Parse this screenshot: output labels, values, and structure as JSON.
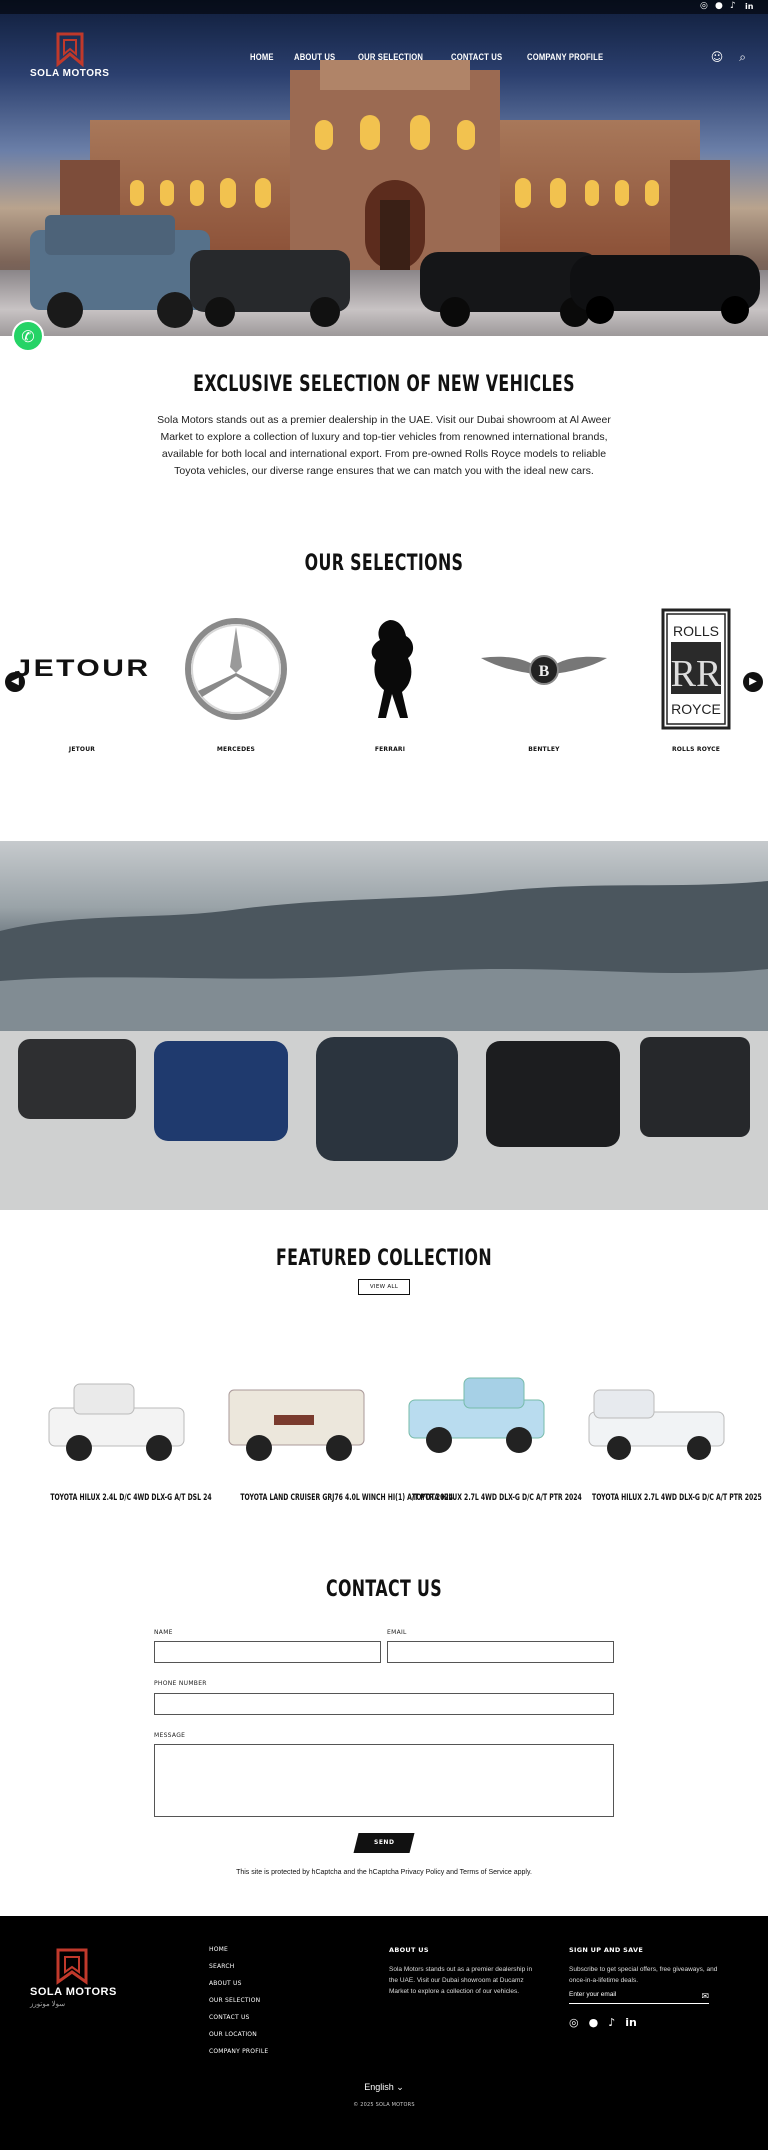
{
  "topbar": {
    "social_icons": [
      "instagram-icon",
      "facebook-icon",
      "tiktok-icon",
      "linkedin-icon"
    ]
  },
  "header": {
    "logo_text": "SOLA MOTORS",
    "nav": [
      "HOME",
      "ABOUT US",
      "OUR SELECTION",
      "CONTACT US",
      "COMPANY PROFILE"
    ],
    "icons": [
      "account-icon",
      "search-icon"
    ]
  },
  "floating": {
    "icon": "whatsapp-icon"
  },
  "intro": {
    "title": "EXCLUSIVE SELECTION OF NEW VEHICLES",
    "body": "Sola Motors stands out as a premier dealership in the UAE. Visit our Dubai showroom at Al Aweer Market to explore a collection of luxury and top-tier vehicles from renowned international brands, available for both local and international export. From pre-owned Rolls Royce models to reliable Toyota vehicles, our diverse range ensures that we can match you with the ideal new cars."
  },
  "selections": {
    "title": "OUR SELECTIONS",
    "brands": [
      {
        "label": "JETOUR",
        "logo_text": "JETOUR"
      },
      {
        "label": "MERCEDES"
      },
      {
        "label": "FERRARI"
      },
      {
        "label": "BENTLEY",
        "logo_text": "B"
      },
      {
        "label": "ROLLS ROYCE",
        "logo_text_top": "ROLLS",
        "logo_text_bottom": "ROYCE",
        "logo_text_mid": "RR"
      }
    ],
    "prev_icon": "chevron-left-icon",
    "next_icon": "chevron-right-icon"
  },
  "featured": {
    "title": "FEATURED COLLECTION",
    "view_all": "VIEW ALL",
    "products": [
      {
        "name": "TOYOTA HILUX 2.4L D/C 4WD DLX-G A/T DSL 24",
        "color": "#f3f3f3"
      },
      {
        "name": "TOYOTA LAND CRUISER GRJ76 4.0L WINCH HI(1) A/T PTR 2024",
        "color": "#ece7dc"
      },
      {
        "name": "TOYOTA HILUX 2.7L 4WD DLX-G D/C A/T PTR 2024",
        "color": "#b9dcef"
      },
      {
        "name": "TOYOTA HILUX 2.7L 4WD DLX-G D/C A/T PTR 2025",
        "color": "#f1f3f5"
      }
    ]
  },
  "contact": {
    "title": "CONTACT US",
    "name_label": "NAME",
    "email_label": "EMAIL",
    "phone_label": "PHONE NUMBER",
    "message_label": "MESSAGE",
    "send": "SEND",
    "captcha": "This site is protected by hCaptcha and the hCaptcha Privacy Policy and Terms of Service apply."
  },
  "footer": {
    "logo_text": "SOLA MOTORS",
    "logo_sub": "سولا موتورز",
    "nav": [
      "HOME",
      "SEARCH",
      "ABOUT US",
      "OUR SELECTION",
      "CONTACT US",
      "OUR LOCATION",
      "COMPANY PROFILE"
    ],
    "about_title": "ABOUT US",
    "about_text": "Sola Motors stands out as a premier dealership in the UAE. Visit our Dubai showroom at Ducamz Market to explore a collection of our vehicles.",
    "signup_title": "SIGN UP AND SAVE",
    "signup_text": "Subscribe to get special offers, free giveaways, and once-in-a-lifetime deals.",
    "email_placeholder": "Enter your email",
    "social_icons": [
      "instagram-icon",
      "facebook-icon",
      "tiktok-icon",
      "linkedin-icon"
    ],
    "language": "English",
    "copyright": "© 2025 SOLA MOTORS"
  }
}
